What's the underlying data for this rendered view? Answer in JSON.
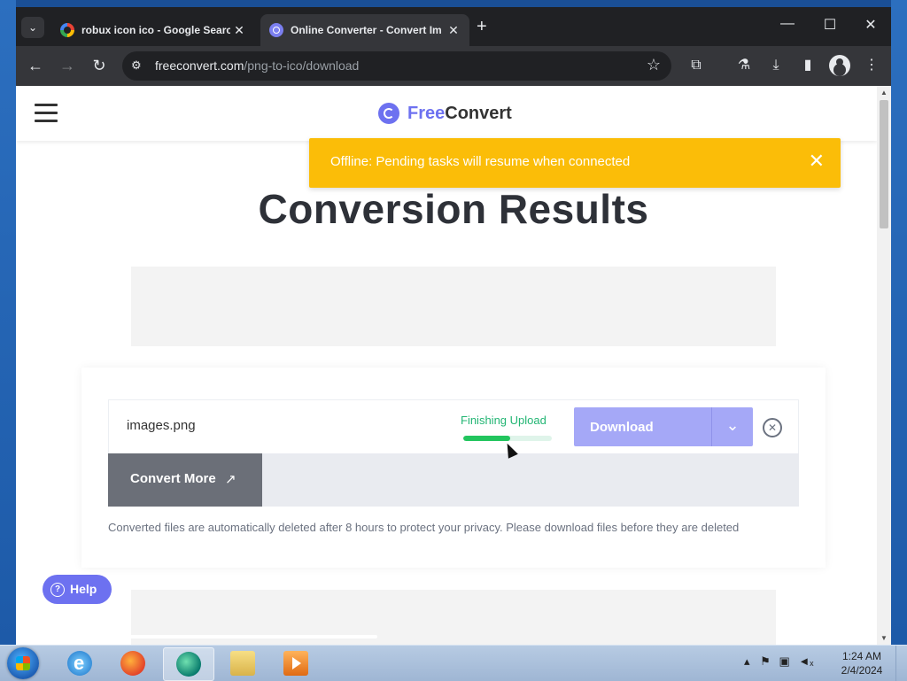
{
  "browser": {
    "tabs": [
      {
        "title": "robux icon ico - Google Search",
        "active": false
      },
      {
        "title": "Online Converter - Convert Im",
        "active": true
      }
    ],
    "new_tab": "+",
    "url_host": "freeconvert.com",
    "url_path": "/png-to-ico/download"
  },
  "site": {
    "logo_free": "Free",
    "logo_convert": "Convert"
  },
  "toast": {
    "message": "Offline: Pending tasks will resume when connected",
    "close": "✕"
  },
  "page": {
    "title": "Conversion Results",
    "file": {
      "name": "images.png",
      "status": "Finishing Upload",
      "progress": 0.53
    },
    "download_label": "Download",
    "convert_more_label": "Convert More",
    "notice": "Converted files are automatically deleted after 8 hours to protect your privacy. Please download files before they are deleted"
  },
  "help": {
    "label": "Help"
  },
  "taskbar": {
    "time": "1:24 AM",
    "date": "2/4/2024",
    "apps": [
      "internet-explorer",
      "firefox",
      "edge",
      "file-explorer",
      "media-player"
    ]
  },
  "colors": {
    "brand": "#6d71f0",
    "toast": "#fbbd08",
    "progress": "#22c55e",
    "status_text": "#22b573",
    "download_button": "#a5a8f7"
  }
}
